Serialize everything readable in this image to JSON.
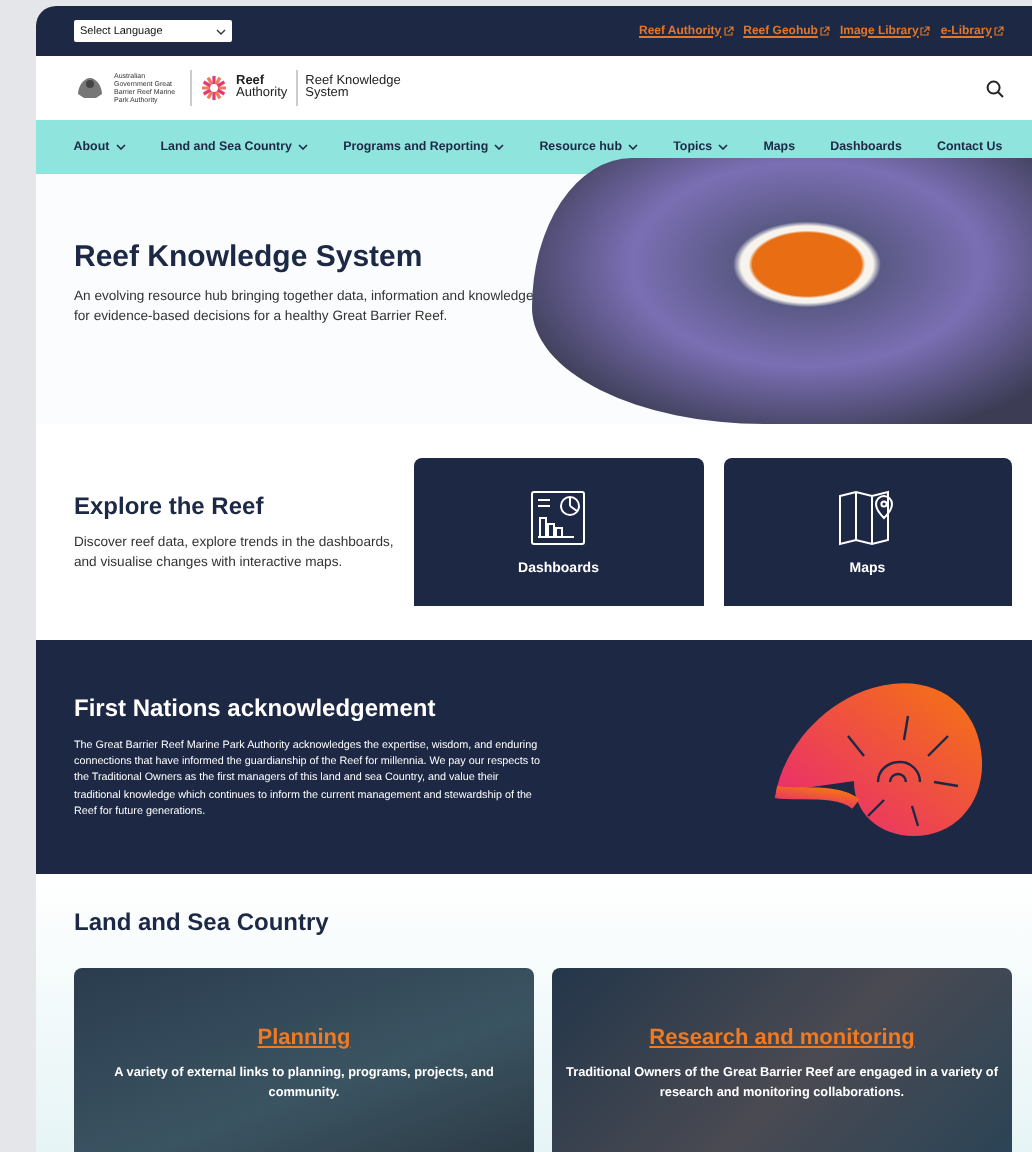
{
  "language_select": {
    "value": "Select Language"
  },
  "top_links": [
    {
      "label": "Reef Authority"
    },
    {
      "label": "Reef Geohub"
    },
    {
      "label": "Image Library"
    },
    {
      "label": "e-Library"
    }
  ],
  "logo": {
    "government": "Australian Government",
    "agency": "Great Barrier Reef Marine Park Authority",
    "brand": "Reef",
    "brand_sub": "Authority",
    "site": "Reef Knowledge System"
  },
  "nav": [
    {
      "label": "About",
      "dropdown": true
    },
    {
      "label": "Land and Sea Country",
      "dropdown": true
    },
    {
      "label": "Programs and Reporting",
      "dropdown": true
    },
    {
      "label": "Resource hub",
      "dropdown": true
    },
    {
      "label": "Topics",
      "dropdown": true
    },
    {
      "label": "Maps",
      "dropdown": false
    },
    {
      "label": "Dashboards",
      "dropdown": false
    },
    {
      "label": "Contact Us",
      "dropdown": false
    }
  ],
  "hero": {
    "title": "Reef Knowledge System",
    "text": "An evolving resource hub bringing together data, information and knowledge for evidence-based decisions for a healthy Great Barrier Reef."
  },
  "explore": {
    "title": "Explore the Reef",
    "text": "Discover reef data, explore trends in the dashboards, and visualise changes with interactive maps.",
    "tiles": [
      {
        "label": "Dashboards",
        "kind": "dashboard"
      },
      {
        "label": "Maps",
        "kind": "map"
      }
    ]
  },
  "acknowledgement": {
    "title": "First Nations acknowledgement",
    "text": "The Great Barrier Reef Marine Park Authority acknowledges the expertise, wisdom, and enduring connections that have informed the guardianship of the Reef for millennia. We pay our respects to the Traditional Owners as the first managers of this land and sea Country, and value their traditional knowledge which continues to inform the current management and stewardship of the Reef for future generations."
  },
  "land_sea": {
    "title": "Land and Sea Country",
    "cards": [
      {
        "title": "Planning",
        "text": "A variety of external links to planning, programs, projects, and community."
      },
      {
        "title": "Research and monitoring",
        "text": "Traditional Owners of the Great Barrier Reef are engaged in a variety of research and monitoring collaborations."
      }
    ]
  }
}
